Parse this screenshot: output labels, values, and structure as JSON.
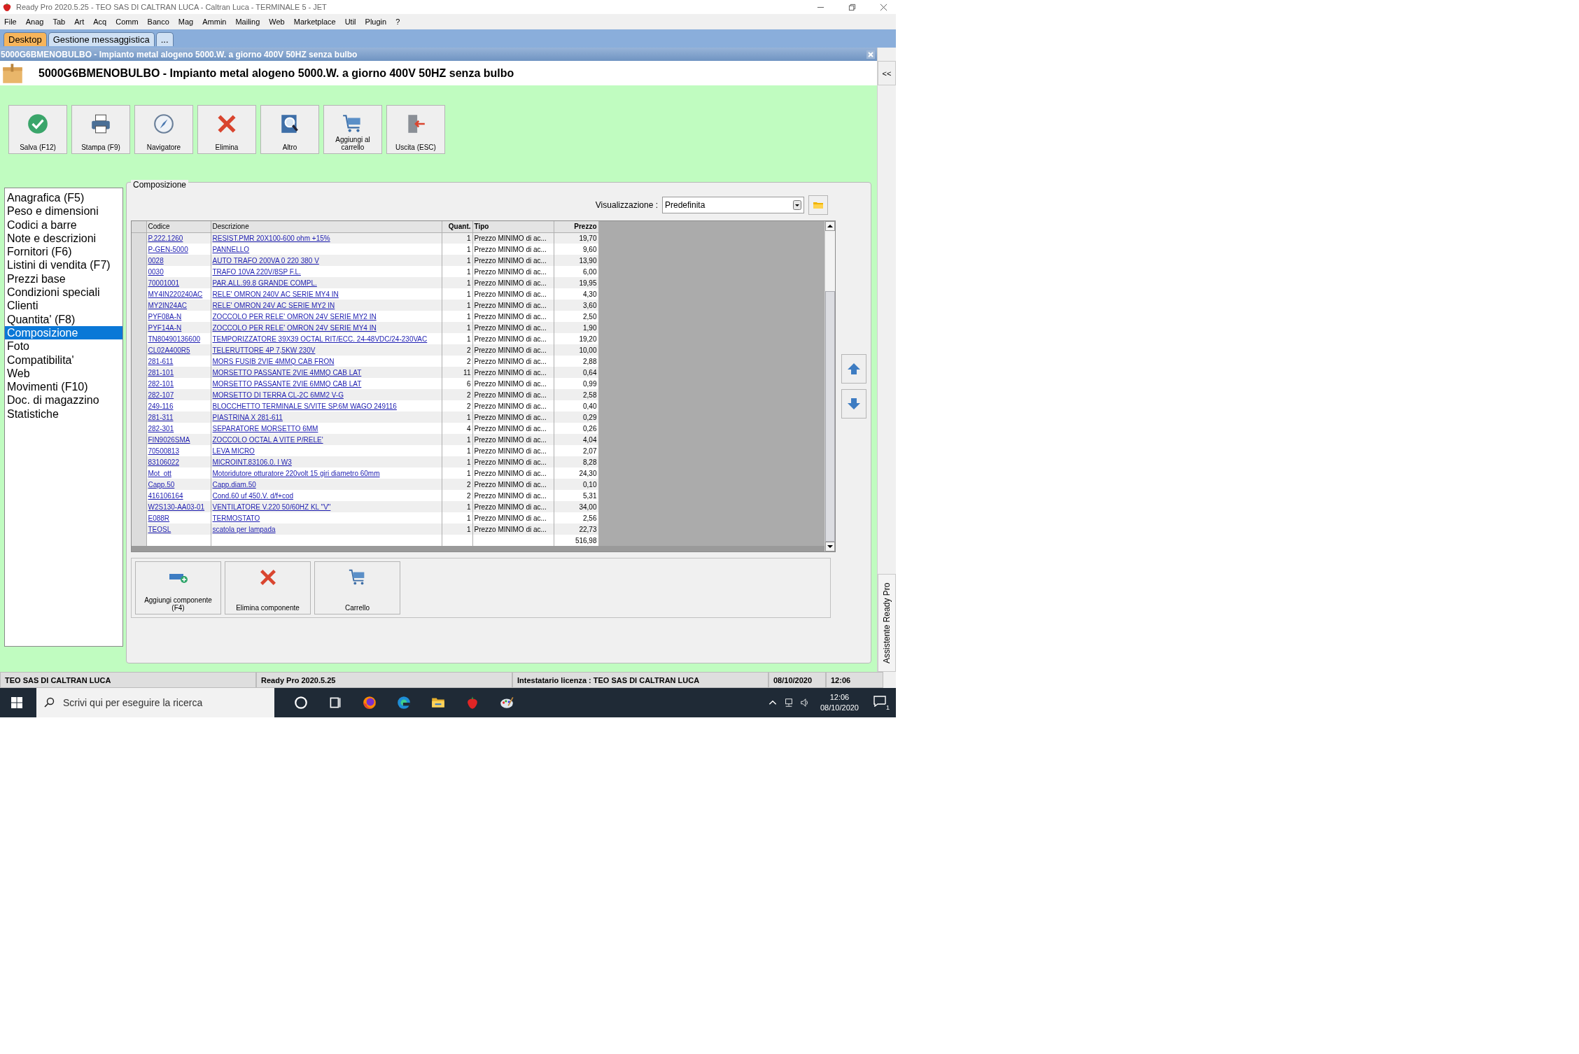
{
  "window": {
    "title": "Ready Pro 2020.5.25 - TEO SAS DI CALTRAN LUCA - Caltran Luca - TERMINALE 5 - JET"
  },
  "menu": [
    "File",
    "Anag",
    "Tab",
    "Art",
    "Acq",
    "Comm",
    "Banco",
    "Mag",
    "Ammin",
    "Mailing",
    "Web",
    "Marketplace",
    "Util",
    "Plugin",
    "?"
  ],
  "tabs": [
    {
      "label": "Desktop",
      "selected": true
    },
    {
      "label": "Gestione messaggistica",
      "selected": false
    },
    {
      "label": "...",
      "selected": false
    }
  ],
  "document": {
    "caption": "5000G6BMENOBULBO - Impianto metal alogeno 5000.W. a giorno 400V 50HZ senza bulbo",
    "title": "5000G6BMENOBULBO - Impianto metal alogeno 5000.W. a giorno 400V 50HZ senza bulbo"
  },
  "toolbar": [
    {
      "label": "Salva (F12)",
      "kind": "check"
    },
    {
      "label": "Stampa (F9)",
      "kind": "print"
    },
    {
      "label": "Navigatore",
      "kind": "compass"
    },
    {
      "label": "Elimina",
      "kind": "delete"
    },
    {
      "label": "Altro",
      "kind": "search"
    },
    {
      "label": "Aggiungi al carrello",
      "kind": "cart"
    },
    {
      "label": "Uscita (ESC)",
      "kind": "exit"
    }
  ],
  "sidebar": {
    "items": [
      {
        "label": "Anagrafica (F5)",
        "selected": false
      },
      {
        "label": "Peso e dimensioni",
        "selected": false
      },
      {
        "label": "Codici a barre",
        "selected": false
      },
      {
        "label": "Note e descrizioni",
        "selected": false
      },
      {
        "label": "Fornitori (F6)",
        "selected": false
      },
      {
        "label": "Listini di vendita (F7)",
        "selected": false
      },
      {
        "label": "Prezzi base",
        "selected": false
      },
      {
        "label": "Condizioni speciali",
        "selected": false
      },
      {
        "label": "Clienti",
        "selected": false
      },
      {
        "label": "Quantita' (F8)",
        "selected": false
      },
      {
        "label": "Composizione",
        "selected": true
      },
      {
        "label": "Foto",
        "selected": false
      },
      {
        "label": "Compatibilita'",
        "selected": false
      },
      {
        "label": "Web",
        "selected": false
      },
      {
        "label": "Movimenti (F10)",
        "selected": false
      },
      {
        "label": "Doc. di magazzino",
        "selected": false
      },
      {
        "label": "Statistiche",
        "selected": false
      }
    ]
  },
  "composition": {
    "title": "Composizione",
    "view_label": "Visualizzazione :",
    "view_value": "Predefinita",
    "table": {
      "columns": [
        "Codice",
        "Descrizione",
        "Quant.",
        "Tipo",
        "Prezzo"
      ],
      "rows": [
        [
          "P.222.1260",
          "RESIST.PMR 20X100-600 ohm +15%",
          "1",
          "Prezzo MINIMO di ac...",
          "19,70"
        ],
        [
          "P-GEN-5000",
          "PANNELLO",
          "1",
          "Prezzo MINIMO di ac...",
          "9,60"
        ],
        [
          "0028",
          "AUTO TRAFO 200VA 0 220 380 V",
          "1",
          "Prezzo MINIMO di ac...",
          "13,90"
        ],
        [
          "0030",
          "TRAFO 10VA 220V/8SP F.L.",
          "1",
          "Prezzo MINIMO di ac...",
          "6,00"
        ],
        [
          "70001001",
          "PAR.ALL.99.8 GRANDE COMPL.",
          "1",
          "Prezzo MINIMO di ac...",
          "19,95"
        ],
        [
          "MY4IN220240AC",
          "RELE' OMRON 240V AC SERIE MY4 IN",
          "1",
          "Prezzo MINIMO di ac...",
          "4,30"
        ],
        [
          "MY2IN24AC",
          "RELE' OMRON 24V AC SERIE MY2 IN",
          "1",
          "Prezzo MINIMO di ac...",
          "3,60"
        ],
        [
          "PYF08A-N",
          "ZOCCOLO PER RELE' OMRON 24V SERIE MY2 IN",
          "1",
          "Prezzo MINIMO di ac...",
          "2,50"
        ],
        [
          "PYF14A-N",
          "ZOCCOLO PER RELE' OMRON 24V SERIE MY4 IN",
          "1",
          "Prezzo MINIMO di ac...",
          "1,90"
        ],
        [
          "TN80490136600",
          "TEMPORIZZATORE 39X39 OCTAL RIT/ECC. 24-48VDC/24-230VAC",
          "1",
          "Prezzo MINIMO di ac...",
          "19,20"
        ],
        [
          "CL02A400R5",
          "TELERUTTORE 4P 7,5KW 230V",
          "2",
          "Prezzo MINIMO di ac...",
          "10,00"
        ],
        [
          "281-611",
          "MORS FUSIB 2VIE 4MMQ CAB FRON",
          "2",
          "Prezzo MINIMO di ac...",
          "2,88"
        ],
        [
          "281-101",
          "MORSETTO PASSANTE 2VIE 4MMQ CAB LAT",
          "11",
          "Prezzo MINIMO di ac...",
          "0,64"
        ],
        [
          "282-101",
          "MORSETTO PASSANTE 2VIE 6MMQ CAB LAT",
          "6",
          "Prezzo MINIMO di ac...",
          "0,99"
        ],
        [
          "282-107",
          "MORSETTO DI TERRA CL-2C 6MM2 V-G",
          "2",
          "Prezzo MINIMO di ac...",
          "2,58"
        ],
        [
          "249-116",
          "BLOCCHETTO TERMINALE S/VITE SP.6M  WAGO 249116",
          "2",
          "Prezzo MINIMO di ac...",
          "0,40"
        ],
        [
          "281-311",
          "PIASTRINA X 281-611",
          "1",
          "Prezzo MINIMO di ac...",
          "0,29"
        ],
        [
          "282-301",
          "SEPARATORE MORSETTO 6MM",
          "4",
          "Prezzo MINIMO di ac...",
          "0,26"
        ],
        [
          "FIN9026SMA",
          "ZOCCOLO OCTAL A VITE P/RELE'",
          "1",
          "Prezzo MINIMO di ac...",
          "4,04"
        ],
        [
          "70500813",
          "LEVA MICRO",
          "1",
          "Prezzo MINIMO di ac...",
          "2,07"
        ],
        [
          "83106022",
          "MICROINT.83106.0. I W3",
          "1",
          "Prezzo MINIMO di ac...",
          "8,28"
        ],
        [
          "Mot_ott",
          "Motoridutore otturatore 220volt 15 giri diametro 60mm",
          "1",
          "Prezzo MINIMO di ac...",
          "24,30"
        ],
        [
          "Capp.50",
          "Capp.diam.50",
          "2",
          "Prezzo MINIMO di ac...",
          "0,10"
        ],
        [
          "416106164",
          "Cond.60 uf 450.V. d/f+cod",
          "2",
          "Prezzo MINIMO di ac...",
          "5,31"
        ],
        [
          "W2S130-AA03-01",
          "VENTILATORE V.220 50/60HZ KL \"V\"",
          "1",
          "Prezzo MINIMO di ac...",
          "34,00"
        ],
        [
          "E088R",
          "TERMOSTATO",
          "1",
          "Prezzo MINIMO di ac...",
          "2,56"
        ],
        [
          "TEOSL",
          "scatola per lampada ",
          "1",
          "Prezzo MINIMO di ac...",
          "22,73"
        ]
      ],
      "total": "516,98"
    },
    "buttons": [
      {
        "label": "Aggiungi componente (F4)",
        "kind": "add"
      },
      {
        "label": "Elimina componente",
        "kind": "delete"
      },
      {
        "label": "Carrello",
        "kind": "cart"
      }
    ]
  },
  "assistant": {
    "collapse": "<<",
    "label": "Assistente Ready Pro"
  },
  "status_bar": [
    "TEO SAS DI CALTRAN LUCA",
    "Ready Pro 2020.5.25",
    "Intestatario licenza : TEO SAS DI CALTRAN LUCA",
    "08/10/2020",
    "12:06"
  ],
  "taskbar": {
    "search_placeholder": "Scrivi qui per eseguire la ricerca",
    "time": "12:06",
    "date": "08/10/2020",
    "notifications": "1"
  }
}
